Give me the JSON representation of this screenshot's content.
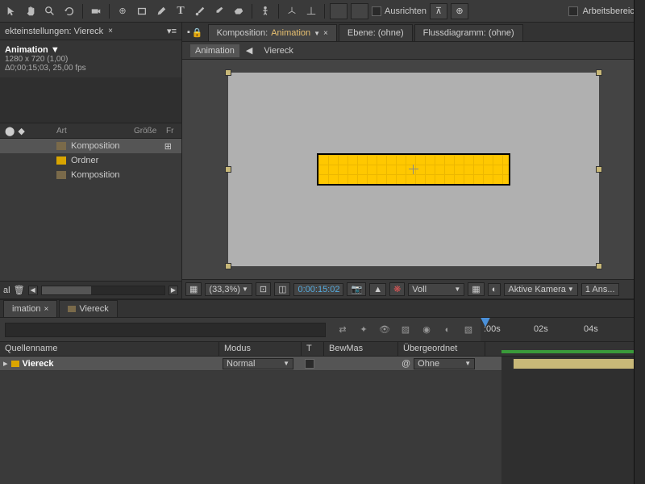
{
  "toolbar": {
    "align_label": "Ausrichten",
    "workspace_label": "Arbeitsbereich:"
  },
  "project_panel": {
    "header": "ekteinstellungen: Viereck",
    "comp_title": "Animation ▼",
    "comp_res": "1280 x 720 (1,00)",
    "comp_dur": "Δ0;00;15;03, 25,00 fps",
    "cols": {
      "art": "Art",
      "size": "Größe",
      "fr": "Fr"
    },
    "items": [
      {
        "name": "Komposition",
        "yellow": false
      },
      {
        "name": "Ordner",
        "yellow": true
      },
      {
        "name": "Komposition",
        "yellow": false
      }
    ],
    "al": "al"
  },
  "comp_tabs": {
    "prefix": "Komposition:",
    "active": "Animation",
    "layer_label": "Ebene: (ohne)",
    "flow_label": "Flussdiagramm: (ohne)"
  },
  "breadcrumb": {
    "a": "Animation",
    "b": "Viereck"
  },
  "viewer_footer": {
    "zoom": "(33,3%)",
    "time": "0:00:15:02",
    "mode": "Voll",
    "camera": "Aktive Kamera",
    "views": "1 Ans..."
  },
  "timeline": {
    "tab1": "imation",
    "tab2": "Viereck",
    "ticks": {
      "t0": ":00s",
      "t1": "02s",
      "t2": "04s"
    },
    "cols": {
      "src": "Quellenname",
      "mode": "Modus",
      "t": "T",
      "bew": "BewMas",
      "parent": "Übergeordnet"
    },
    "row": {
      "name": "Viereck",
      "mode": "Normal",
      "parent": "Ohne"
    }
  }
}
